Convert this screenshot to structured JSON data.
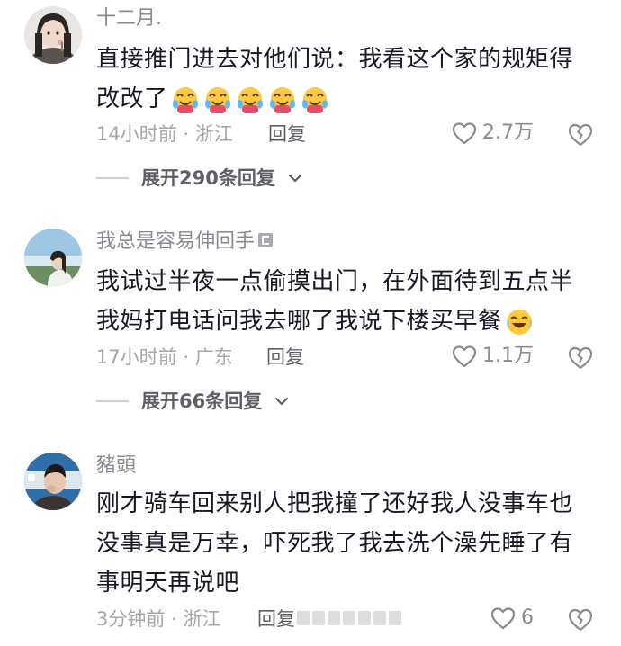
{
  "comments": [
    {
      "username": "十二月.",
      "text": "直接推门进去对他们说：我看这个家的规矩得改改了",
      "emoji": "laughing-crying-emoji",
      "emoji_count": 5,
      "time_location": "14小时前 · 浙江",
      "reply_label": "回复",
      "likes": "2.7万",
      "expand_label": "展开290条回复"
    },
    {
      "username": "我总是容易伸回手",
      "text": "我试过半夜一点偷摸出门，在外面待到五点半我妈打电话问我去哪了我说下楼买早餐",
      "emoji": "crying-laughing-emoji",
      "time_location": "17小时前 · 广东",
      "reply_label": "回复",
      "likes": "1.1万",
      "expand_label": "展开66条回复"
    },
    {
      "username": "豬頭",
      "text": "刚才骑车回来别人把我撞了还好我人没事车也没事真是万幸，吓死我了我去洗个澡先睡了有事明天再说吧",
      "time_location": "3分钟前 · 浙江",
      "reply_label": "回复",
      "likes": "6"
    }
  ],
  "colors": {
    "text": "#161823",
    "muted": "#8a8b91",
    "secondary": "#5f6066"
  }
}
